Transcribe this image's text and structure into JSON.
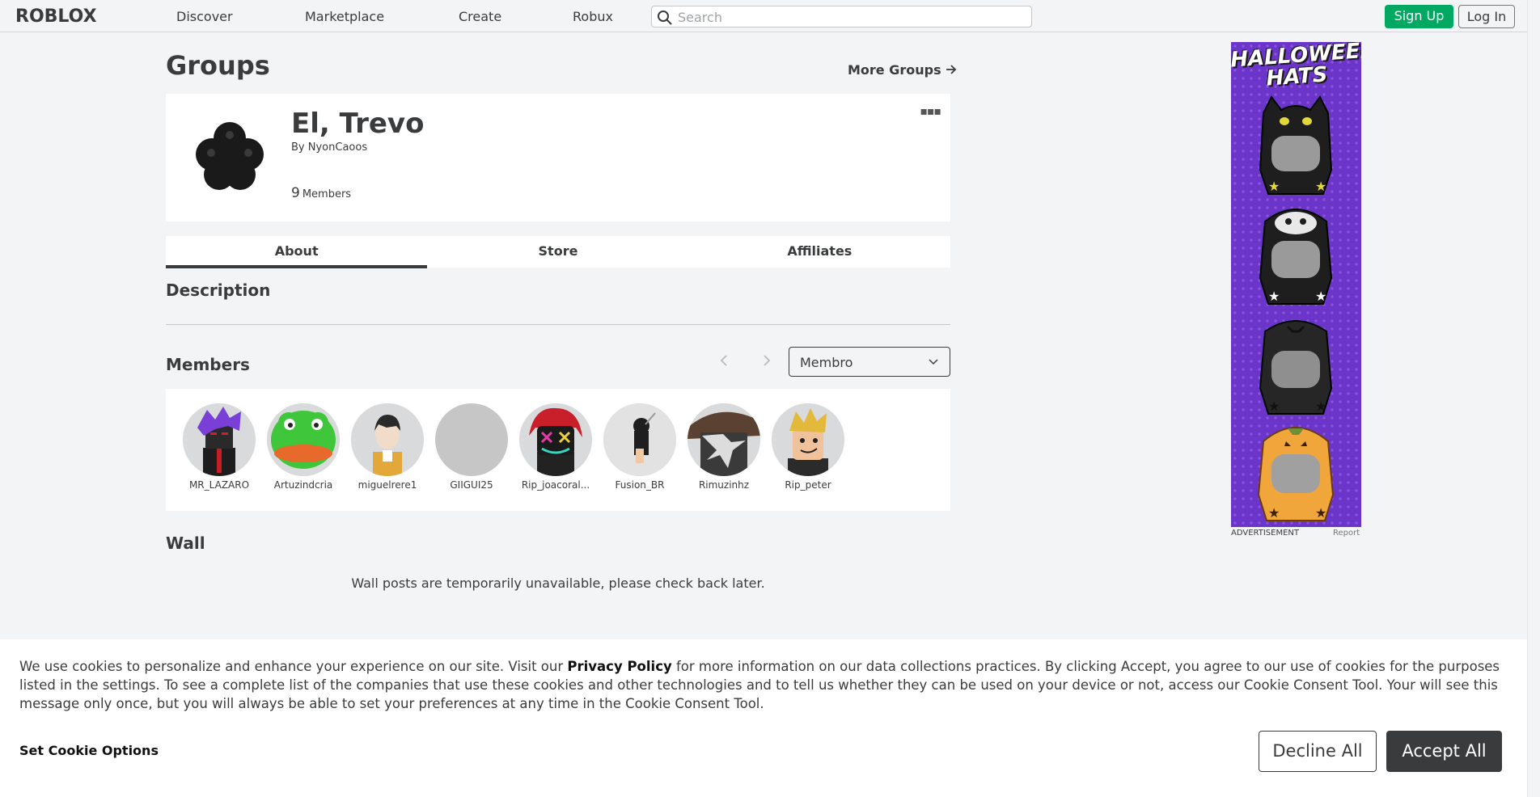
{
  "nav": {
    "logo": "ROBLOX",
    "links": [
      "Discover",
      "Marketplace",
      "Create",
      "Robux"
    ],
    "search_placeholder": "Search",
    "signup_label": "Sign Up",
    "login_label": "Log In"
  },
  "page": {
    "title": "Groups",
    "more_groups": "More Groups"
  },
  "group": {
    "name": "El, Trevo",
    "by_label": "By",
    "owner": "NyonCaoos",
    "member_count": "9",
    "members_label": "Members"
  },
  "tabs": [
    "About",
    "Store",
    "Affiliates"
  ],
  "description_heading": "Description",
  "members_section": {
    "heading": "Members",
    "role_filter": "Membro",
    "members": [
      {
        "name": "MR_LAZARO",
        "color": "#6d3fb5"
      },
      {
        "name": "Artuzindcria",
        "color": "#3fc63a"
      },
      {
        "name": "miguelrere1",
        "color": "#e9e6e2"
      },
      {
        "name": "GIIGUI25",
        "color": "#c6c6c6"
      },
      {
        "name": "Rip_joacoral...",
        "color": "#c81f2a"
      },
      {
        "name": "Fusion_BR",
        "color": "#e2e2e2"
      },
      {
        "name": "Rimuzinhz",
        "color": "#5a4131"
      },
      {
        "name": "Rip_peter",
        "color": "#e2b93b"
      }
    ]
  },
  "wall": {
    "heading": "Wall",
    "message": "Wall posts are temporarily unavailable, please check back later."
  },
  "ad": {
    "title_line1": "HALLOWEEN",
    "title_line2": "HATS",
    "label": "ADVERTISEMENT",
    "report": "Report"
  },
  "cookie": {
    "text_before": "We use cookies to personalize and enhance your experience on our site. Visit our ",
    "privacy_link": "Privacy Policy",
    "text_after": " for more information on our data collections practices. By clicking Accept, you agree to our use of cookies for the purposes listed in the settings. To see a complete list of the companies that use these cookies and other technologies and to tell us whether they can be used on your device or not, access our Cookie Consent Tool. Your will see this message only once, but you will always be able to set your preferences at any time in the Cookie Consent Tool.",
    "set_options": "Set Cookie Options",
    "decline": "Decline All",
    "accept": "Accept All"
  }
}
